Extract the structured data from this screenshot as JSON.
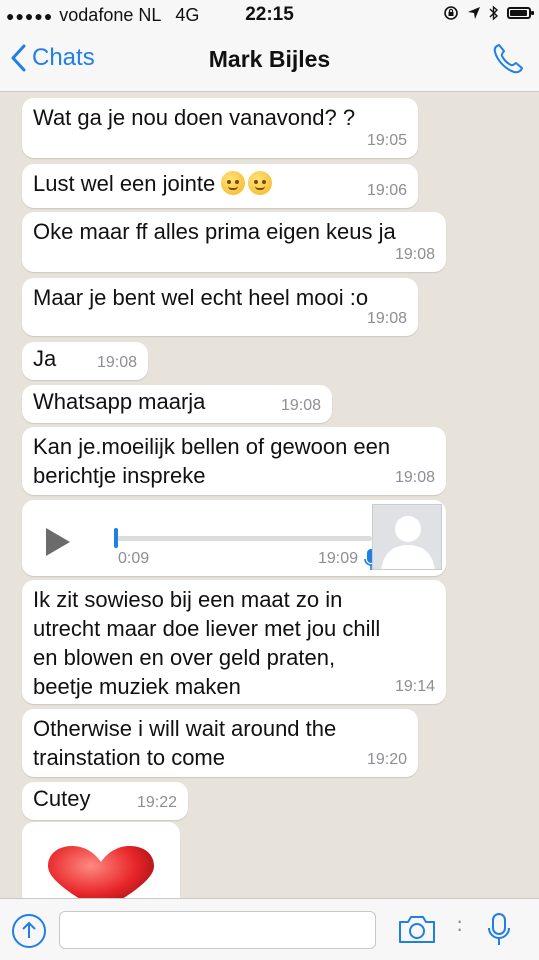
{
  "status": {
    "carrier": "vodafone NL",
    "network": "4G",
    "time": "22:15",
    "battery_level": 0.92
  },
  "header": {
    "back_label": "Chats",
    "title": "Mark Bijles",
    "icons": [
      "chevron-left-icon",
      "phone-icon"
    ]
  },
  "messages": [
    {
      "text": "Wat ga je nou doen vanavond? ?",
      "time": "19:05"
    },
    {
      "text": "Lust wel een jointe",
      "emoji": [
        "confounded-face",
        "smiling-blushing-face"
      ],
      "time": "19:06"
    },
    {
      "text": "Oke maar ff alles prima eigen keus ja",
      "time": "19:08"
    },
    {
      "text": "Maar je bent wel echt heel mooi :o",
      "time": "19:08"
    },
    {
      "text": "Ja",
      "time": "19:08"
    },
    {
      "text": "Whatsapp maarja",
      "time": "19:08"
    },
    {
      "text": "Kan je.moeilijk bellen of gewoon een\nberichtje inspreke",
      "time": "19:08"
    },
    {
      "voice": true,
      "duration": "0:09",
      "time": "19:09",
      "progress": 0.0
    },
    {
      "text": "Ik zit sowieso bij een maat zo in\nutrecht maar doe liever met jou chill\nen blowen en over geld praten,\nbeetje muziek maken",
      "time": "19:14"
    },
    {
      "text": "Otherwise i will wait around the\ntrainstation to come",
      "time": "19:20"
    },
    {
      "text": "Cutey",
      "time": "19:22"
    }
  ],
  "heart_message": {
    "icon": "heart-icon",
    "color": "#e8272b"
  },
  "input": {
    "placeholder": "",
    "icons": [
      "upload-icon",
      "camera-icon",
      "microphone-icon"
    ]
  },
  "colors": {
    "accent": "#1f7fe5",
    "background": "#e7e2da",
    "bubble": "#ffffff",
    "timestamp": "#8e8e93"
  }
}
